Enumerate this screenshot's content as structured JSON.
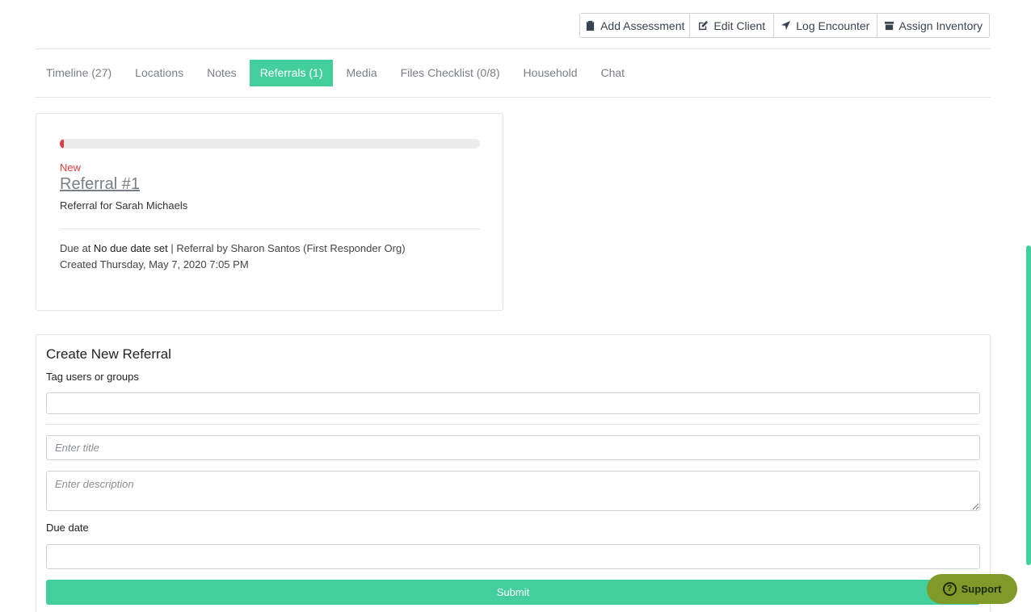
{
  "toolbar": {
    "add_assessment": "Add Assessment",
    "edit_client": "Edit Client",
    "log_encounter": "Log Encounter",
    "assign_inventory": "Assign Inventory"
  },
  "tabs": [
    {
      "label": "Timeline (27)"
    },
    {
      "label": "Locations"
    },
    {
      "label": "Notes"
    },
    {
      "label": "Referrals (1)",
      "active": true
    },
    {
      "label": "Media"
    },
    {
      "label": "Files Checklist (0/8)"
    },
    {
      "label": "Household"
    },
    {
      "label": "Chat"
    }
  ],
  "referral": {
    "progress_percent": 1,
    "status": "New",
    "title": "Referral #1",
    "description": "Referral for Sarah Michaels",
    "due_prefix": "Due at ",
    "due_value": "No due date set",
    "referral_by": " | Referral by Sharon Santos (First Responder Org)",
    "created": "Created Thursday, May 7, 2020 7:05 PM"
  },
  "form": {
    "title": "Create New Referral",
    "tag_label": "Tag users or groups",
    "tag_value": "",
    "title_placeholder": "Enter title",
    "description_placeholder": "Enter description",
    "due_label": "Due date",
    "due_value": "",
    "submit_label": "Submit"
  },
  "support": {
    "label": "Support"
  },
  "colors": {
    "accent": "#43cf9c",
    "status_new": "#e53e3e",
    "support_bg": "#7e9a28"
  }
}
